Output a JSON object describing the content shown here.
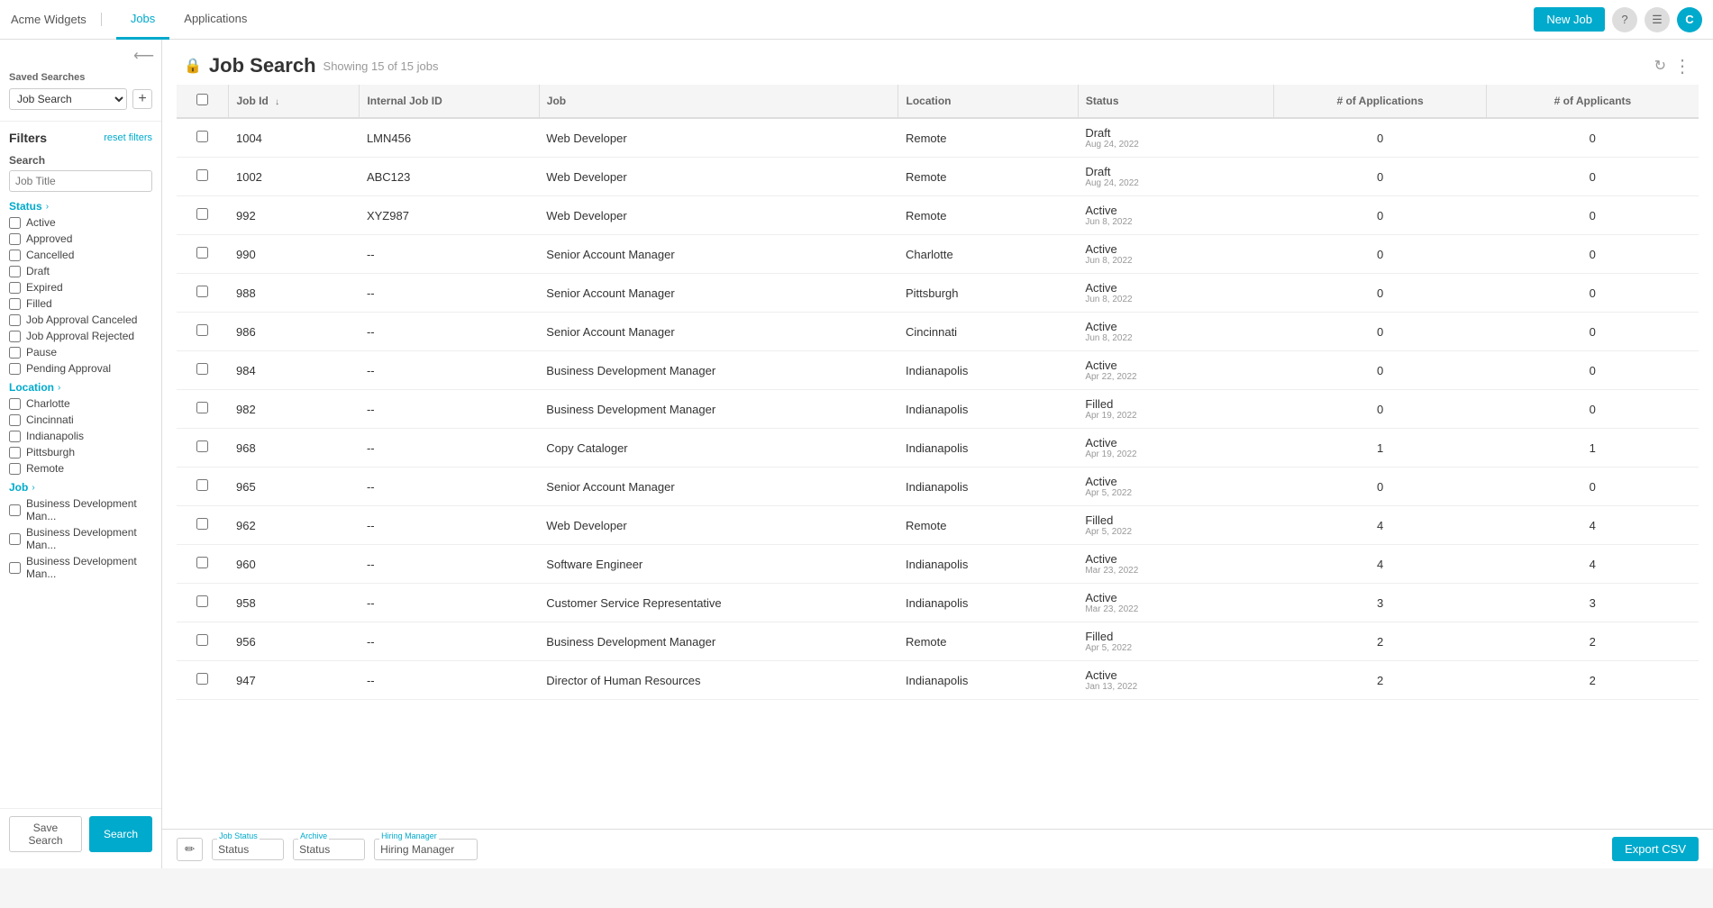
{
  "topnav": {
    "brand": "Acme Widgets",
    "links": [
      {
        "label": "Jobs",
        "active": true
      },
      {
        "label": "Applications",
        "active": false
      }
    ],
    "new_job_label": "New Job",
    "user_initial": "C"
  },
  "sidebar": {
    "saved_searches_label": "Saved Searches",
    "saved_searches_value": "Job Search",
    "filters_title": "Filters",
    "reset_label": "reset filters",
    "search_label": "Search",
    "search_placeholder": "Job Title",
    "status_group": "Status",
    "status_items": [
      "Active",
      "Approved",
      "Cancelled",
      "Draft",
      "Expired",
      "Filled",
      "Job Approval Canceled",
      "Job Approval Rejected",
      "Pause",
      "Pending Approval"
    ],
    "location_group": "Location",
    "location_items": [
      "Charlotte",
      "Cincinnati",
      "Indianapolis",
      "Pittsburgh",
      "Remote"
    ],
    "job_group": "Job",
    "job_items": [
      "Business Development Man...",
      "Business Development Man...",
      "Business Development Man..."
    ],
    "save_search_label": "Save Search",
    "search_btn_label": "Search"
  },
  "main": {
    "lock_icon": "🔒",
    "title": "Job Search",
    "showing_text": "Showing 15 of 15 jobs",
    "columns": [
      "",
      "Job Id",
      "Internal Job ID",
      "Job",
      "Location",
      "Status",
      "# of Applications",
      "# of Applicants"
    ],
    "rows": [
      {
        "check": false,
        "jobId": "1004",
        "intJobId": "LMN456",
        "job": "Web Developer",
        "location": "Remote",
        "status": "Draft",
        "statusDate": "Aug 24, 2022",
        "apps": "0",
        "applicants": "0"
      },
      {
        "check": false,
        "jobId": "1002",
        "intJobId": "ABC123",
        "job": "Web Developer",
        "location": "Remote",
        "status": "Draft",
        "statusDate": "Aug 24, 2022",
        "apps": "0",
        "applicants": "0"
      },
      {
        "check": false,
        "jobId": "992",
        "intJobId": "XYZ987",
        "job": "Web Developer",
        "location": "Remote",
        "status": "Active",
        "statusDate": "Jun 8, 2022",
        "apps": "0",
        "applicants": "0"
      },
      {
        "check": false,
        "jobId": "990",
        "intJobId": "--",
        "job": "Senior Account Manager",
        "location": "Charlotte",
        "status": "Active",
        "statusDate": "Jun 8, 2022",
        "apps": "0",
        "applicants": "0"
      },
      {
        "check": false,
        "jobId": "988",
        "intJobId": "--",
        "job": "Senior Account Manager",
        "location": "Pittsburgh",
        "status": "Active",
        "statusDate": "Jun 8, 2022",
        "apps": "0",
        "applicants": "0"
      },
      {
        "check": false,
        "jobId": "986",
        "intJobId": "--",
        "job": "Senior Account Manager",
        "location": "Cincinnati",
        "status": "Active",
        "statusDate": "Jun 8, 2022",
        "apps": "0",
        "applicants": "0"
      },
      {
        "check": false,
        "jobId": "984",
        "intJobId": "--",
        "job": "Business Development Manager",
        "location": "Indianapolis",
        "status": "Active",
        "statusDate": "Apr 22, 2022",
        "apps": "0",
        "applicants": "0"
      },
      {
        "check": false,
        "jobId": "982",
        "intJobId": "--",
        "job": "Business Development Manager",
        "location": "Indianapolis",
        "status": "Filled",
        "statusDate": "Apr 19, 2022",
        "apps": "0",
        "applicants": "0"
      },
      {
        "check": false,
        "jobId": "968",
        "intJobId": "--",
        "job": "Copy Cataloger",
        "location": "Indianapolis",
        "status": "Active",
        "statusDate": "Apr 19, 2022",
        "apps": "1",
        "applicants": "1"
      },
      {
        "check": false,
        "jobId": "965",
        "intJobId": "--",
        "job": "Senior Account Manager",
        "location": "Indianapolis",
        "status": "Active",
        "statusDate": "Apr 5, 2022",
        "apps": "0",
        "applicants": "0"
      },
      {
        "check": false,
        "jobId": "962",
        "intJobId": "--",
        "job": "Web Developer",
        "location": "Remote",
        "status": "Filled",
        "statusDate": "Apr 5, 2022",
        "apps": "4",
        "applicants": "4"
      },
      {
        "check": false,
        "jobId": "960",
        "intJobId": "--",
        "job": "Software Engineer",
        "location": "Indianapolis",
        "status": "Active",
        "statusDate": "Mar 23, 2022",
        "apps": "4",
        "applicants": "4"
      },
      {
        "check": false,
        "jobId": "958",
        "intJobId": "--",
        "job": "Customer Service Representative",
        "location": "Indianapolis",
        "status": "Active",
        "statusDate": "Mar 23, 2022",
        "apps": "3",
        "applicants": "3"
      },
      {
        "check": false,
        "jobId": "956",
        "intJobId": "--",
        "job": "Business Development Manager",
        "location": "Remote",
        "status": "Filled",
        "statusDate": "Apr 5, 2022",
        "apps": "2",
        "applicants": "2"
      },
      {
        "check": false,
        "jobId": "947",
        "intJobId": "--",
        "job": "Director of Human Resources",
        "location": "Indianapolis",
        "status": "Active",
        "statusDate": "Jan 13, 2022",
        "apps": "2",
        "applicants": "2"
      }
    ]
  },
  "bottombar": {
    "job_status_label": "Job Status",
    "job_status_value": "Status",
    "archive_label": "Archive",
    "archive_value": "Status",
    "hiring_manager_label": "Hiring Manager",
    "hiring_manager_value": "Hiring Manager",
    "export_label": "Export CSV"
  }
}
